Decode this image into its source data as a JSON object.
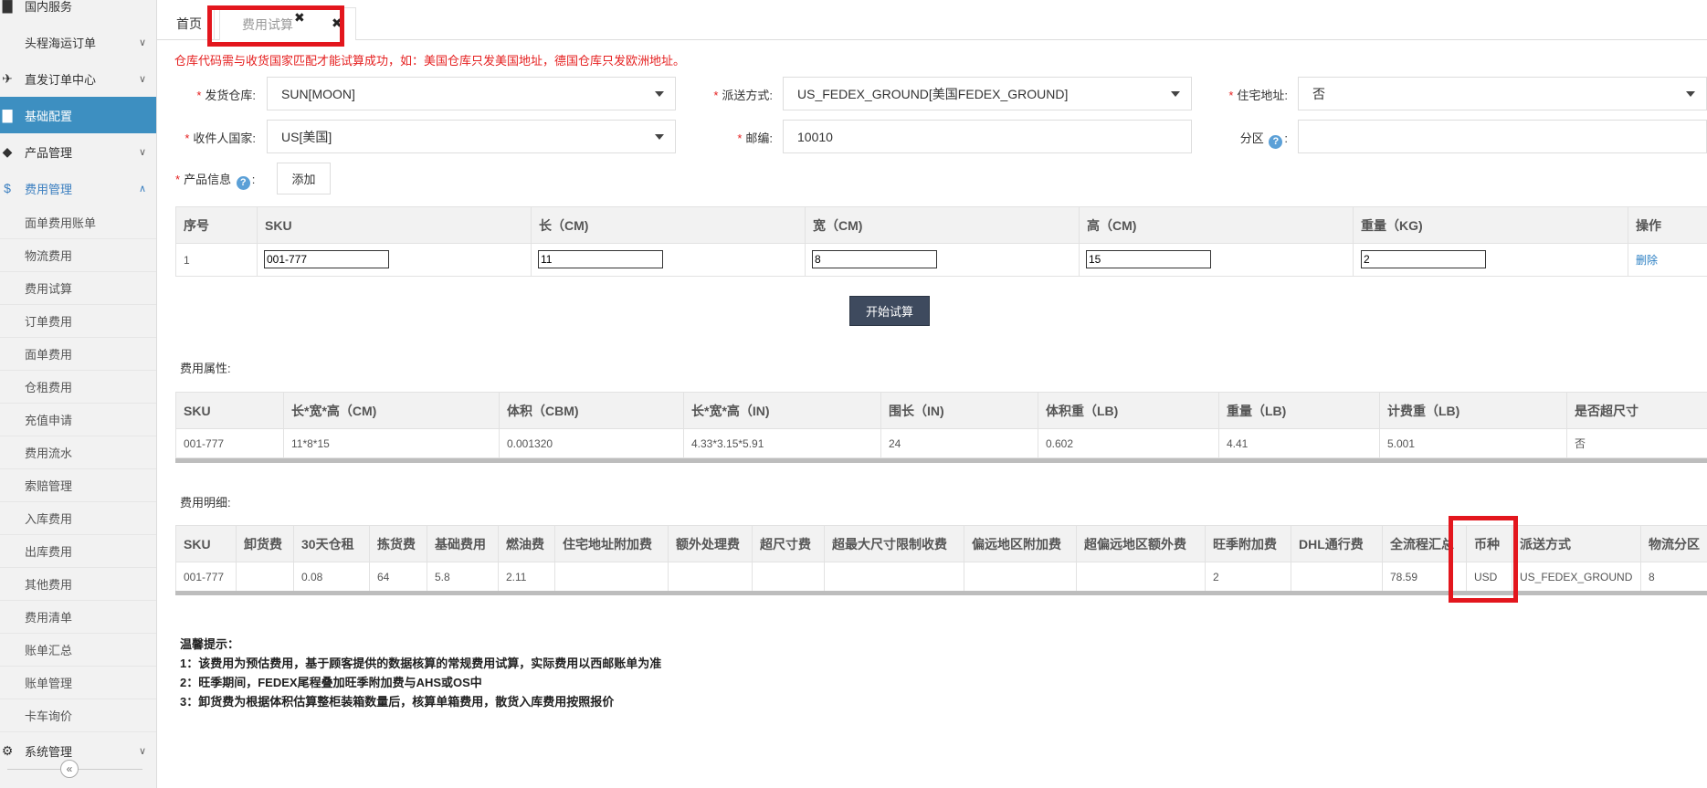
{
  "sidebar": {
    "items": [
      {
        "label": "国内服务",
        "icon": "folder-icon"
      },
      {
        "label": "头程海运订单"
      },
      {
        "label": "直发订单中心",
        "icon": "plane-icon"
      },
      {
        "label": "基础配置",
        "icon": "folder-icon"
      },
      {
        "label": "产品管理",
        "icon": "tag-icon"
      },
      {
        "label": "费用管理",
        "icon": "dollar-icon"
      }
    ],
    "sub_items": [
      "面单费用账单",
      "物流费用",
      "费用试算",
      "订单费用",
      "面单费用",
      "仓租费用",
      "充值申请",
      "费用流水",
      "索赔管理",
      "入库费用",
      "出库费用",
      "其他费用",
      "费用清单",
      "账单汇总",
      "账单管理",
      "卡车询价"
    ],
    "bottom_item": {
      "label": "系统管理",
      "icon": "gear-icon"
    },
    "collapse_glyph": "«"
  },
  "tabs": {
    "home": "首页",
    "active": "费用试算",
    "close_glyph": "✖",
    "more_glyph": "✖"
  },
  "form": {
    "notice": "仓库代码需与收货国家匹配才能试算成功，如：美国仓库只发美国地址，德国仓库只发欧洲地址。",
    "required_mark": "*",
    "warehouse": {
      "label": "发货仓库:",
      "value": "SUN[MOON]"
    },
    "shipping": {
      "label": "派送方式:",
      "value": "US_FEDEX_GROUND[美国FEDEX_GROUND]"
    },
    "residential": {
      "label": "住宅地址:",
      "value": "否"
    },
    "country": {
      "label": "收件人国家:",
      "value": "US[美国]"
    },
    "postcode": {
      "label": "邮编:",
      "value": "10010"
    },
    "zone": {
      "label": "分区",
      "help": "?",
      "suffix": ":",
      "value": ""
    },
    "product": {
      "label": "产品信息",
      "help": "?",
      "suffix": ":",
      "add_button": "添加"
    }
  },
  "product_table": {
    "headers": [
      "序号",
      "SKU",
      "长（CM)",
      "宽（CM)",
      "高（CM)",
      "重量（KG)",
      "操作"
    ],
    "row": {
      "index": "1",
      "sku": "001-777",
      "length": "11",
      "width": "8",
      "height": "15",
      "weight": "2",
      "action": "删除"
    }
  },
  "calc_button": "开始试算",
  "attributes": {
    "title": "费用属性:",
    "headers": [
      "SKU",
      "长*宽*高（CM)",
      "体积（CBM)",
      "长*宽*高（IN)",
      "围长（IN)",
      "体积重（LB)",
      "重量（LB)",
      "计费重（LB)",
      "是否超尺寸"
    ],
    "row": [
      "001-777",
      "11*8*15",
      "0.001320",
      "4.33*3.15*5.91",
      "24",
      "0.602",
      "4.41",
      "5.001",
      "否"
    ]
  },
  "details": {
    "title": "费用明细:",
    "headers": [
      "SKU",
      "卸货费",
      "30天仓租",
      "拣货费",
      "基础费用",
      "燃油费",
      "住宅地址附加费",
      "额外处理费",
      "超尺寸费",
      "超最大尺寸限制收费",
      "偏远地区附加费",
      "超偏远地区额外费",
      "旺季附加费",
      "DHL通行费",
      "全流程汇总",
      "币种",
      "派送方式",
      "物流分区"
    ],
    "row": [
      "001-777",
      "",
      "0.08",
      "64",
      "5.8",
      "2.11",
      "",
      "",
      "",
      "",
      "",
      "",
      "2",
      "",
      "78.59",
      "USD",
      "US_FEDEX_GROUND",
      "8"
    ]
  },
  "tips": {
    "title": "温馨提示：",
    "lines": [
      "1：该费用为预估费用，基于顾客提供的数据核算的常规费用试算，实际费用以西邮账单为准",
      "2：旺季期间，FEDEX尾程叠加旺季附加费与AHS或OS中",
      "3：卸货费为根据体积估算整柜装箱数量后，核算单箱费用，散货入库费用按照报价"
    ]
  }
}
